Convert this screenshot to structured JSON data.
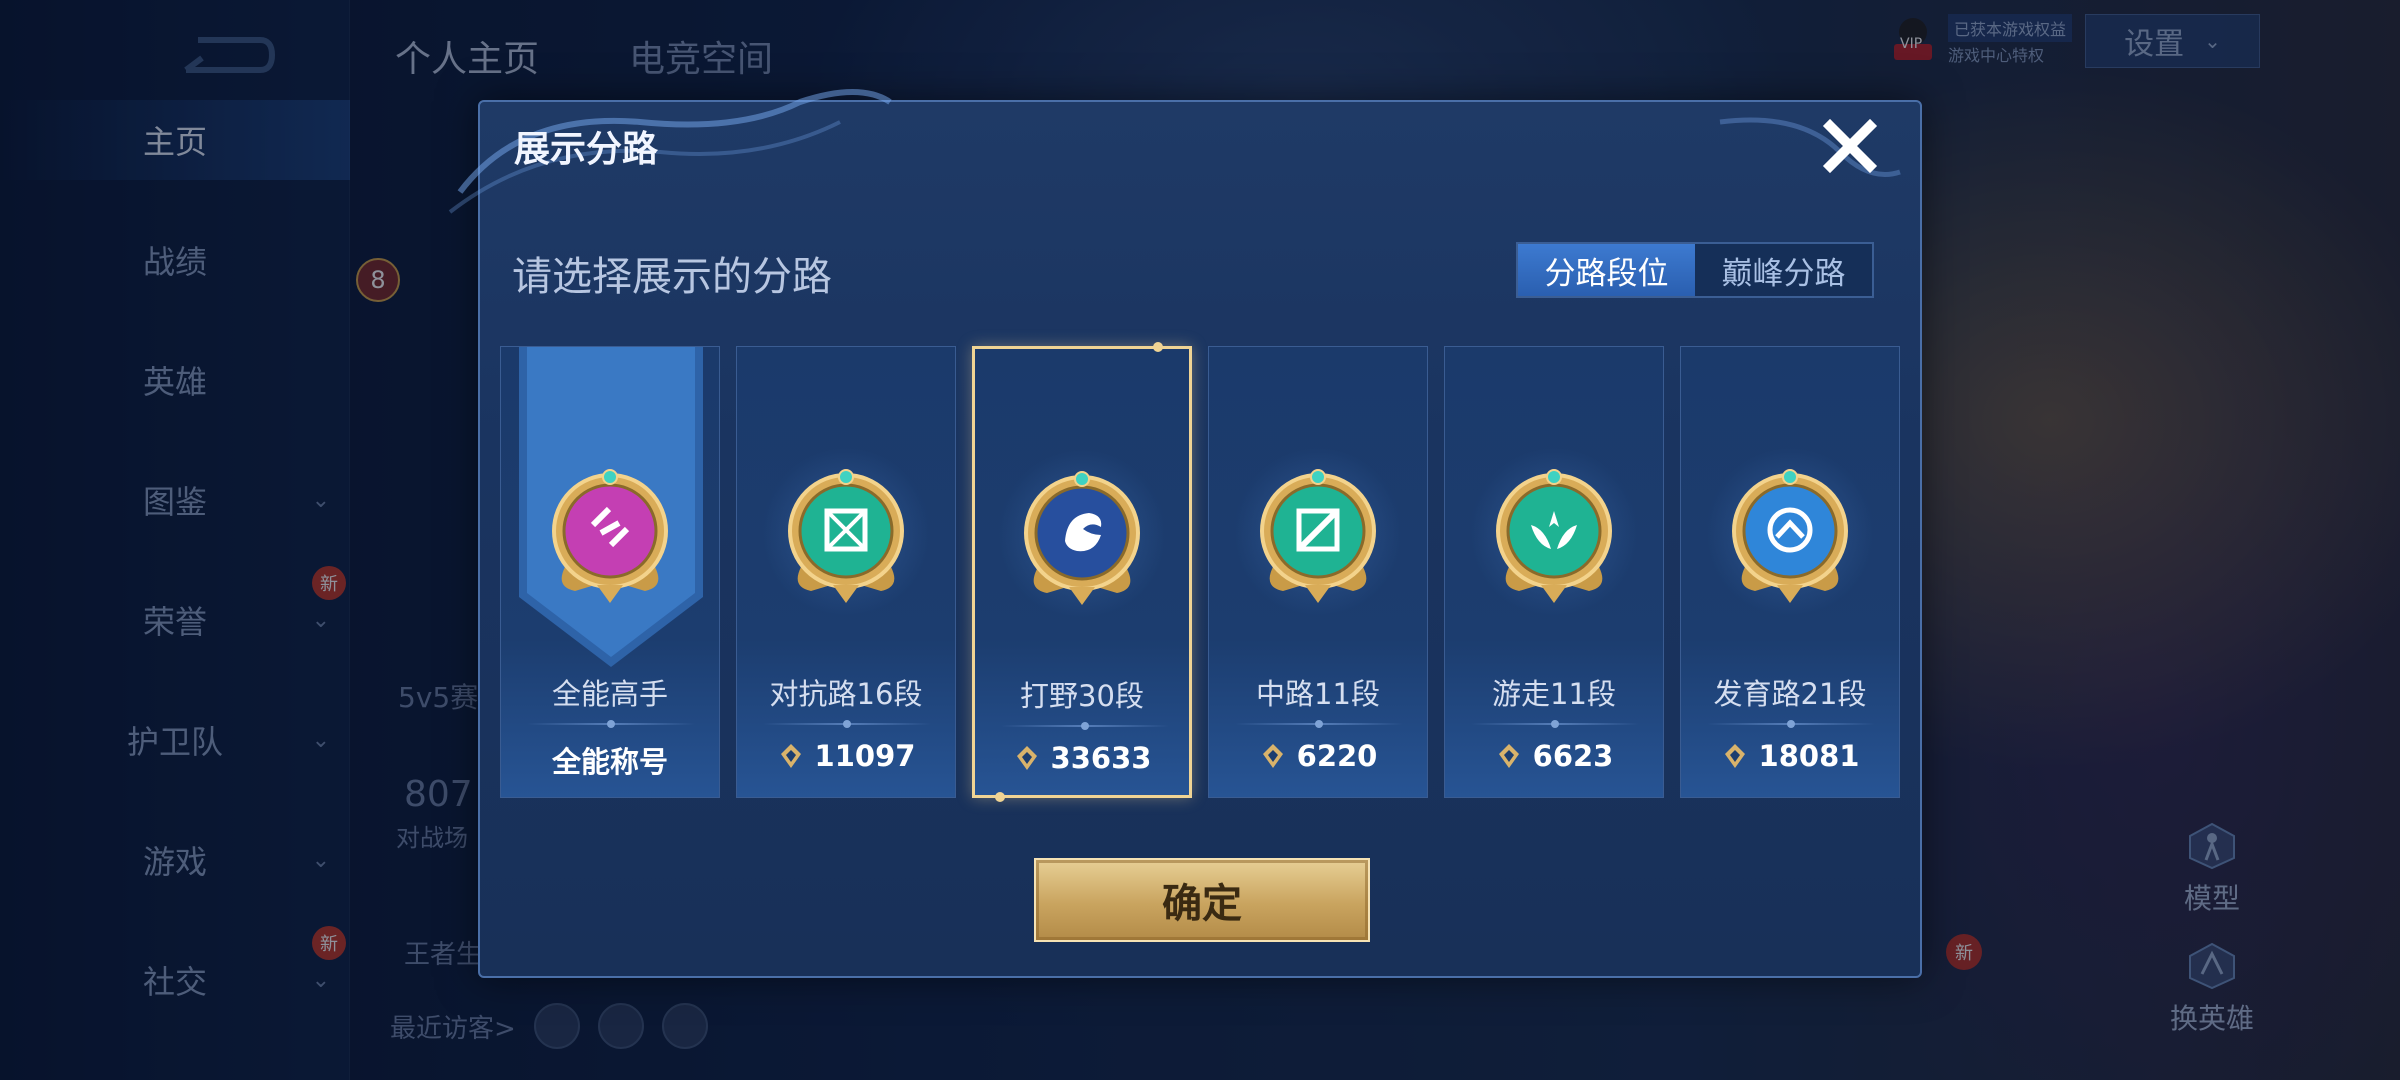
{
  "background": {
    "top_tabs": [
      "个人主页",
      "电竞空间"
    ],
    "nav_items": [
      {
        "label": "主页",
        "active": true,
        "chevron": false,
        "badge": ""
      },
      {
        "label": "战绩",
        "active": false,
        "chevron": false,
        "badge": ""
      },
      {
        "label": "英雄",
        "active": false,
        "chevron": false,
        "badge": ""
      },
      {
        "label": "图鉴",
        "active": false,
        "chevron": true,
        "badge": ""
      },
      {
        "label": "荣誉",
        "active": false,
        "chevron": true,
        "badge": "新"
      },
      {
        "label": "护卫队",
        "active": false,
        "chevron": true,
        "badge": ""
      },
      {
        "label": "游戏",
        "active": false,
        "chevron": true,
        "badge": ""
      },
      {
        "label": "社交",
        "active": false,
        "chevron": true,
        "badge": "新"
      }
    ],
    "settings_label": "设置",
    "vip_label": "VIP",
    "vip_text_1": "已获本游戏权益",
    "vip_text_2": "游戏中心特权",
    "side_text_1": "5v5赛",
    "side_text_2": "807",
    "side_text_3": "对战场",
    "side_text_4": "王者生",
    "level_badge": "8",
    "recent_visitors": "最近访客>",
    "right_buttons": [
      "模型",
      "换英雄"
    ],
    "right_badge": "新"
  },
  "modal": {
    "title": "展示分路",
    "subtitle": "请选择展示的分路",
    "toggle": [
      {
        "label": "分路段位",
        "active": true
      },
      {
        "label": "巅峰分路",
        "active": false
      }
    ],
    "cards": [
      {
        "label": "全能高手",
        "value": "全能称号",
        "show_icon": false,
        "selected": false,
        "emblem": "all-round",
        "color": "#c43fb3"
      },
      {
        "label": "对抗路16段",
        "value": "11097",
        "show_icon": true,
        "selected": false,
        "emblem": "clash-lane",
        "color": "#1fb393"
      },
      {
        "label": "打野30段",
        "value": "33633",
        "show_icon": true,
        "selected": true,
        "emblem": "jungle",
        "color": "#274f9e"
      },
      {
        "label": "中路11段",
        "value": "6220",
        "show_icon": true,
        "selected": false,
        "emblem": "mid-lane",
        "color": "#1fb393"
      },
      {
        "label": "游走11段",
        "value": "6623",
        "show_icon": true,
        "selected": false,
        "emblem": "roam",
        "color": "#1fb393"
      },
      {
        "label": "发育路21段",
        "value": "18081",
        "show_icon": true,
        "selected": false,
        "emblem": "farm-lane",
        "color": "#2f86d9"
      }
    ],
    "confirm_label": "确定"
  }
}
